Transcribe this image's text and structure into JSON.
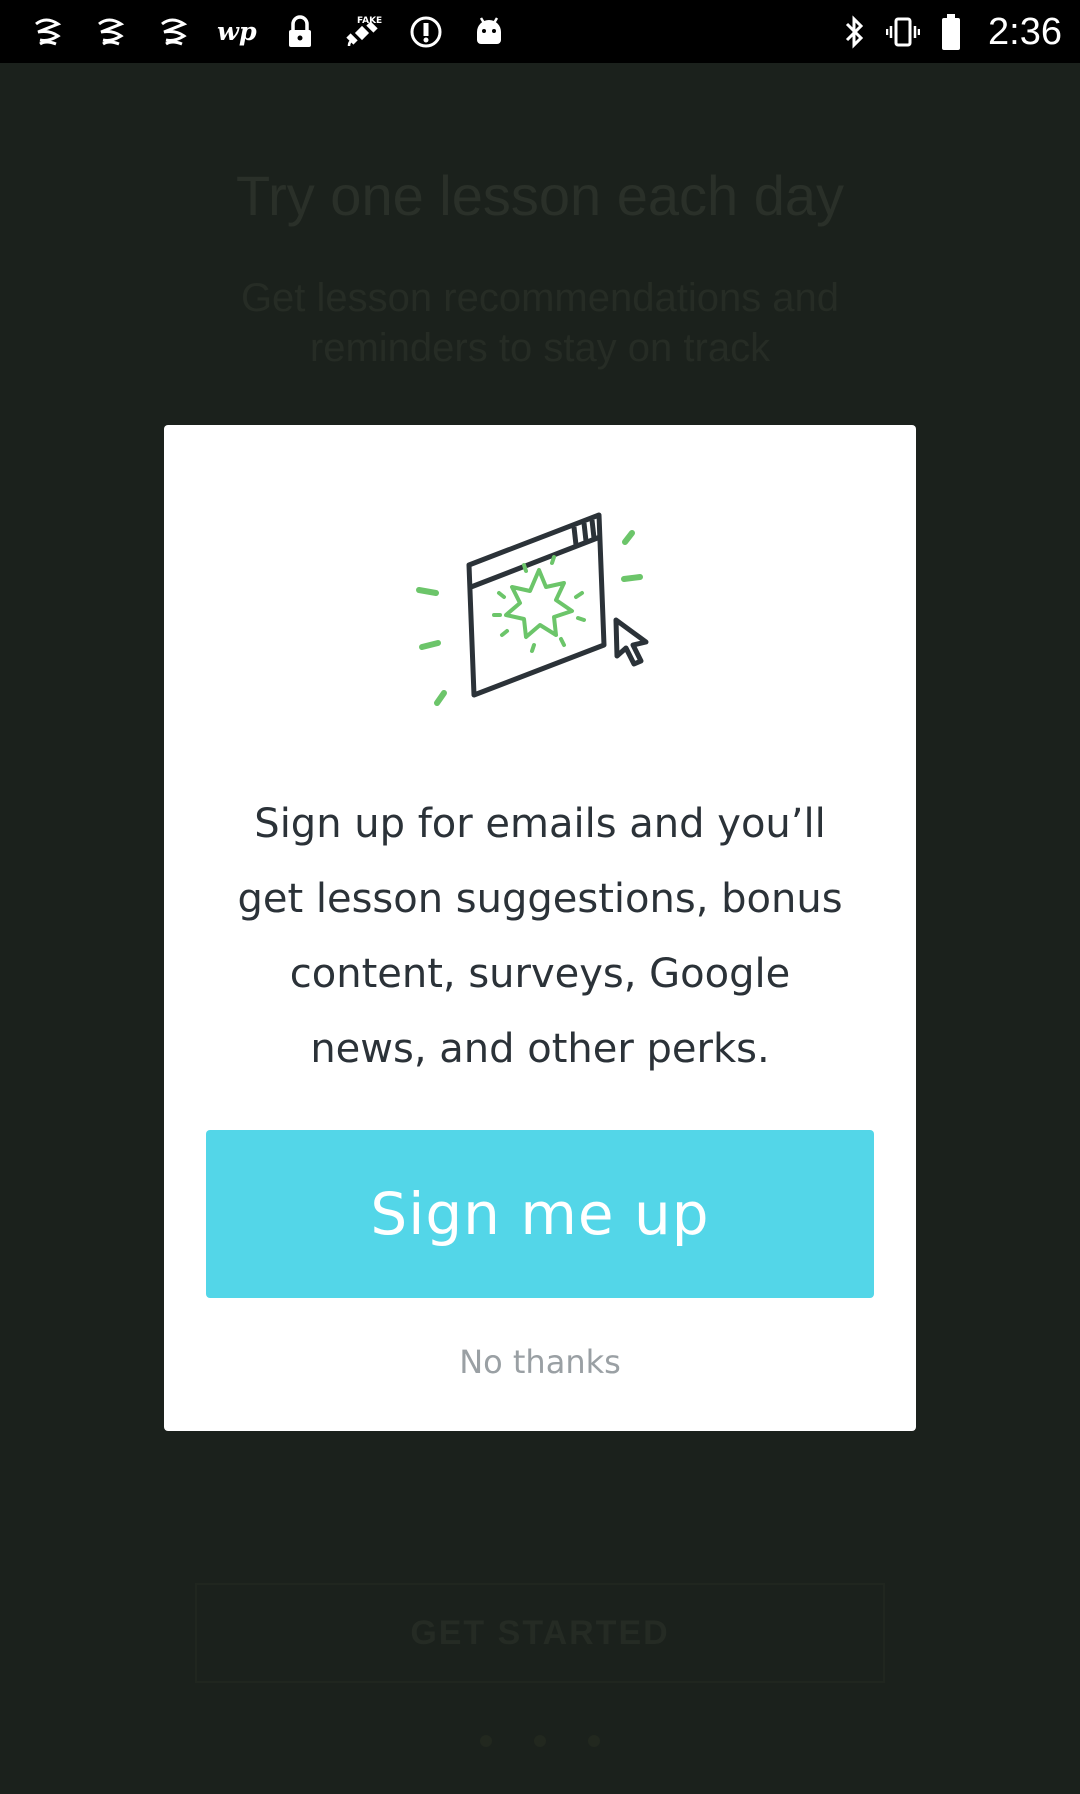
{
  "status_bar": {
    "left_icons": [
      "yarn-icon",
      "yarn-icon",
      "yarn-icon",
      "washington-post-icon",
      "lock-icon",
      "fake-gps-satellite-icon",
      "circle-info-icon",
      "android-icon"
    ],
    "right_icons": [
      "bluetooth-icon",
      "vibrate-icon",
      "battery-icon"
    ],
    "time": "2:36"
  },
  "background": {
    "title": "Try one lesson each day",
    "subtitle": "Get lesson recommendations and reminders to stay on track",
    "button_label": "GET STARTED"
  },
  "modal": {
    "illustration": "browser-window-burst-icon",
    "message_lines": [
      "Sign up for emails and you’ll",
      "get lesson suggestions, bonus",
      "content, surveys, Google",
      "news, and other perks."
    ],
    "primary_button": "Sign me up",
    "secondary_link": "No thanks"
  },
  "colors": {
    "accent": "#53d6e8",
    "illustration_green": "#6cc56a",
    "illustration_ink": "#2b3238",
    "overlay": "#1b211c"
  }
}
